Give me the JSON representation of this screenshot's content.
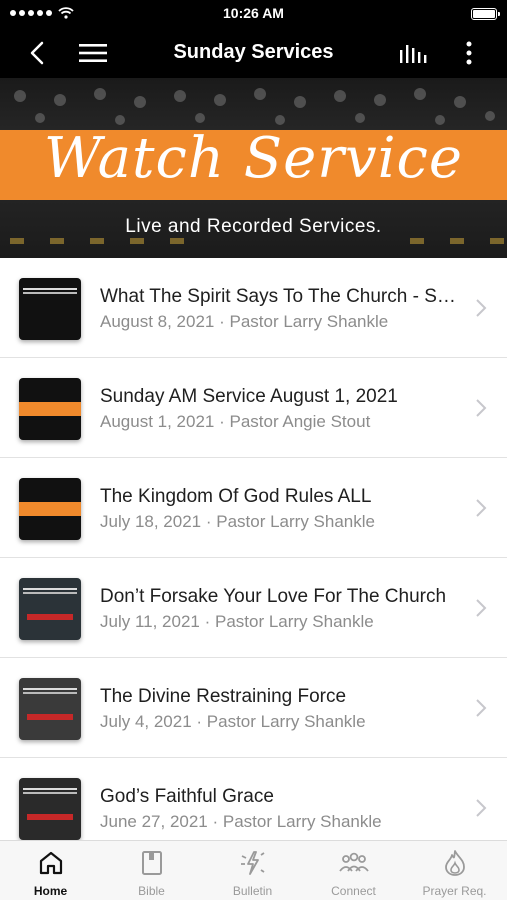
{
  "status_bar": {
    "time": "10:26 AM"
  },
  "nav": {
    "title": "Sunday Services"
  },
  "banner": {
    "title": "Watch Service",
    "subtitle": "Live and Recorded Services."
  },
  "sermons": [
    {
      "title": "What The Spirit Says To The Church - Sunday AM Service",
      "meta": "August 8, 2021 · Pastor Larry Shankle"
    },
    {
      "title": "Sunday AM Service August 1, 2021",
      "meta": "August 1, 2021 · Pastor Angie Stout"
    },
    {
      "title": "The Kingdom Of God Rules ALL",
      "meta": "July 18, 2021 · Pastor Larry Shankle"
    },
    {
      "title": "Don’t Forsake Your Love For The Church",
      "meta": "July 11, 2021 · Pastor Larry Shankle"
    },
    {
      "title": "The Divine Restraining Force",
      "meta": "July 4, 2021 · Pastor Larry Shankle"
    },
    {
      "title": "God’s Faithful Grace",
      "meta": "June 27, 2021 · Pastor Larry Shankle"
    }
  ],
  "tabs": [
    {
      "label": "Home",
      "icon": "home-icon",
      "active": true
    },
    {
      "label": "Bible",
      "icon": "bible-icon"
    },
    {
      "label": "Bulletin",
      "icon": "bulletin-icon"
    },
    {
      "label": "Connect",
      "icon": "connect-icon"
    },
    {
      "label": "Prayer Req.",
      "icon": "prayer-icon"
    }
  ],
  "colors": {
    "accent_orange": "#f08a2c",
    "bar_black": "#000000",
    "meta_gray": "#8c8c8c"
  }
}
